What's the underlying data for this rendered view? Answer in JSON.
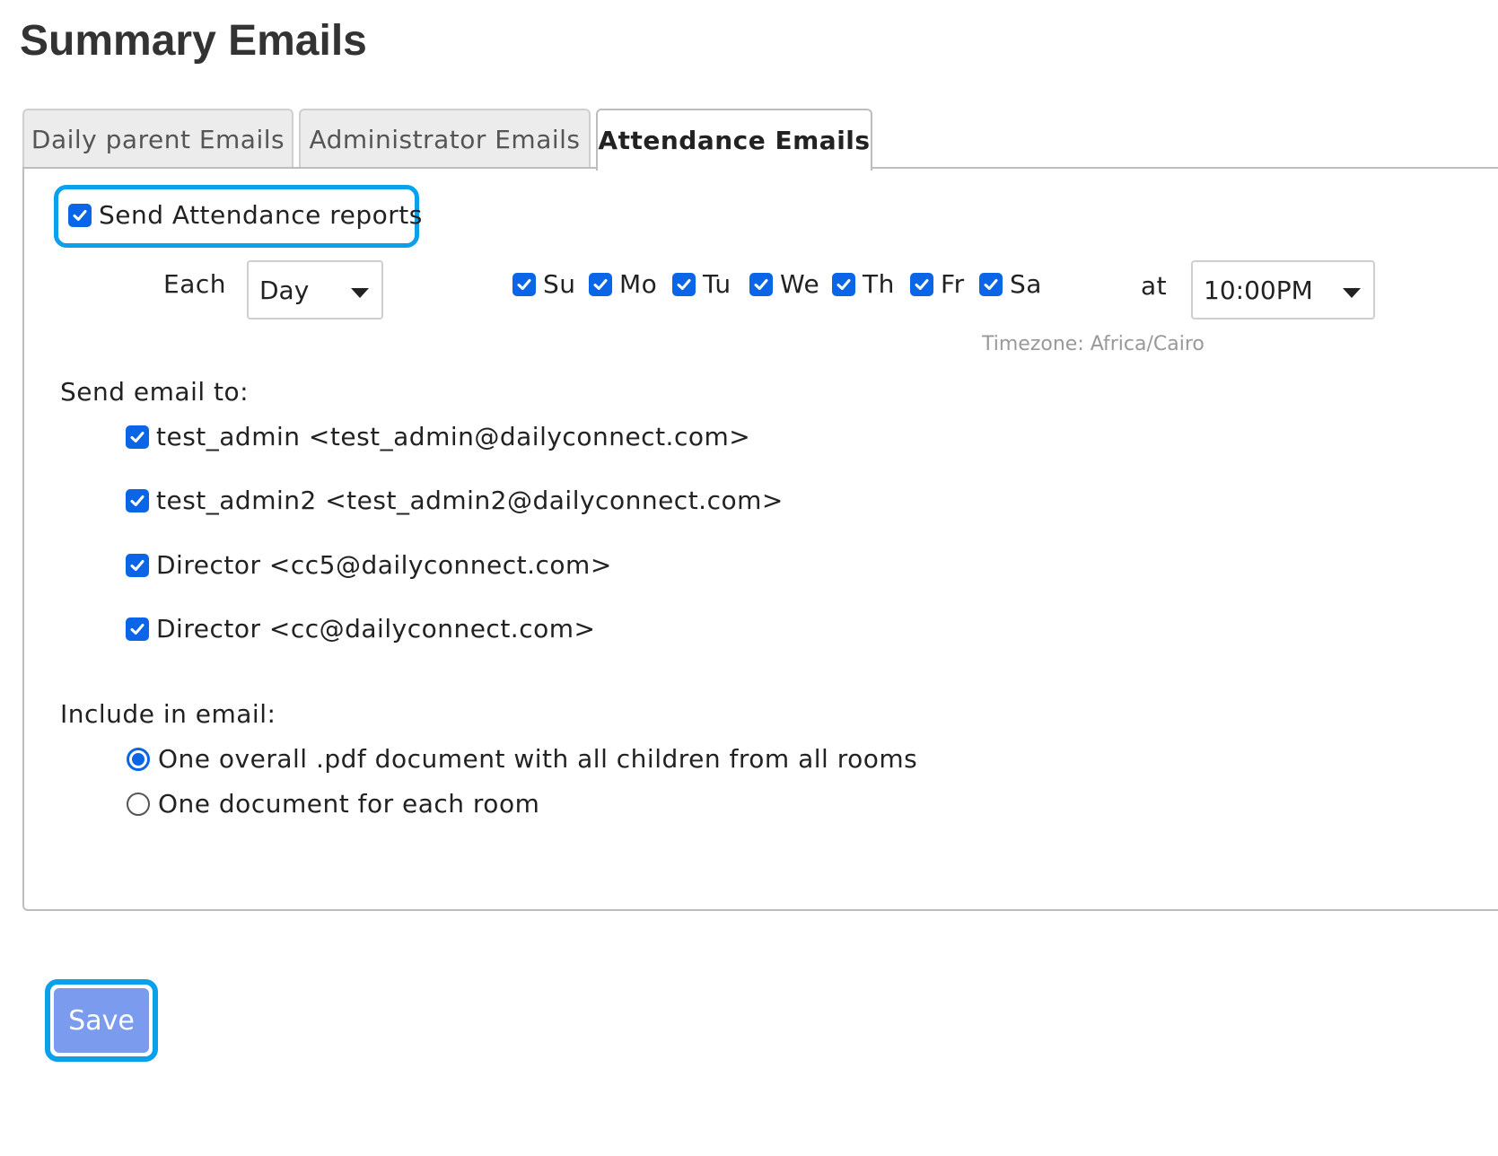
{
  "page": {
    "title": "Summary Emails"
  },
  "tabs": [
    {
      "label": "Daily parent Emails",
      "active": false
    },
    {
      "label": "Administrator Emails",
      "active": false
    },
    {
      "label": "Attendance Emails",
      "active": true
    }
  ],
  "attendance": {
    "send_reports": {
      "label": "Send Attendance reports",
      "checked": true
    },
    "each_label": "Each",
    "frequency": {
      "selected": "Day"
    },
    "days": [
      {
        "label": "Su",
        "checked": true
      },
      {
        "label": "Mo",
        "checked": true
      },
      {
        "label": "Tu",
        "checked": true
      },
      {
        "label": "We",
        "checked": true
      },
      {
        "label": "Th",
        "checked": true
      },
      {
        "label": "Fr",
        "checked": true
      },
      {
        "label": "Sa",
        "checked": true
      }
    ],
    "at_label": "at",
    "time": {
      "selected": "10:00PM"
    },
    "timezone": "Timezone: Africa/Cairo",
    "send_to_label": "Send email to:",
    "recipients": [
      {
        "label": "test_admin <test_admin@dailyconnect.com>",
        "checked": true
      },
      {
        "label": "test_admin2 <test_admin2@dailyconnect.com>",
        "checked": true
      },
      {
        "label": "Director <cc5@dailyconnect.com>",
        "checked": true
      },
      {
        "label": "Director <cc@dailyconnect.com>",
        "checked": true
      }
    ],
    "include_label": "Include in email:",
    "include_options": [
      {
        "label": "One overall .pdf document with all children from all rooms",
        "selected": true
      },
      {
        "label": "One document for each room",
        "selected": false
      }
    ]
  },
  "actions": {
    "save_label": "Save"
  },
  "colors": {
    "accent": "#0a66e6",
    "highlight": "#0aa0ea",
    "save_button": "#7b9cee"
  }
}
